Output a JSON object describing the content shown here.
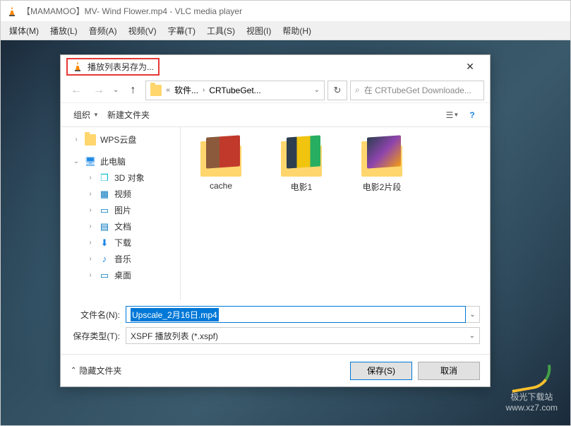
{
  "vlc": {
    "title": "【MAMAMOO】MV- Wind Flower.mp4 - VLC media player",
    "menu": [
      "媒体(M)",
      "播放(L)",
      "音频(A)",
      "视频(V)",
      "字幕(T)",
      "工具(S)",
      "视图(I)",
      "帮助(H)"
    ]
  },
  "dialog": {
    "title": "播放列表另存为...",
    "close": "✕",
    "nav": {
      "back": "←",
      "fwd": "→",
      "up": "↑"
    },
    "address": {
      "chev_left": "«",
      "seg1": "软件...",
      "seg2": "CRTubeGet...",
      "dropdown": "⌄"
    },
    "refresh": "↻",
    "search": {
      "icon": "⌕",
      "placeholder": "在 CRTubeGet Downloade..."
    },
    "toolbar": {
      "organize": "组织",
      "newfolder": "新建文件夹",
      "view": "☰",
      "help": "?"
    },
    "tree": {
      "wps": "WPS云盘",
      "pc": "此电脑",
      "items": [
        {
          "icon": "3d",
          "label": "3D 对象"
        },
        {
          "icon": "video",
          "label": "视频"
        },
        {
          "icon": "pic",
          "label": "图片"
        },
        {
          "icon": "doc",
          "label": "文档"
        },
        {
          "icon": "dl",
          "label": "下载"
        },
        {
          "icon": "music",
          "label": "音乐"
        },
        {
          "icon": "desk",
          "label": "桌面"
        }
      ]
    },
    "files": [
      {
        "name": "cache"
      },
      {
        "name": "电影1"
      },
      {
        "name": "电影2片段"
      }
    ],
    "filename_label": "文件名(N):",
    "filename_value": "Upscale_2月16日.mp4",
    "filetype_label": "保存类型(T):",
    "filetype_value": "XSPF 播放列表 (*.xspf)",
    "hide_folders": "隐藏文件夹",
    "save": "保存(S)",
    "cancel": "取消"
  },
  "watermark": {
    "line1": "极光下载站",
    "line2": "www.xz7.com"
  }
}
